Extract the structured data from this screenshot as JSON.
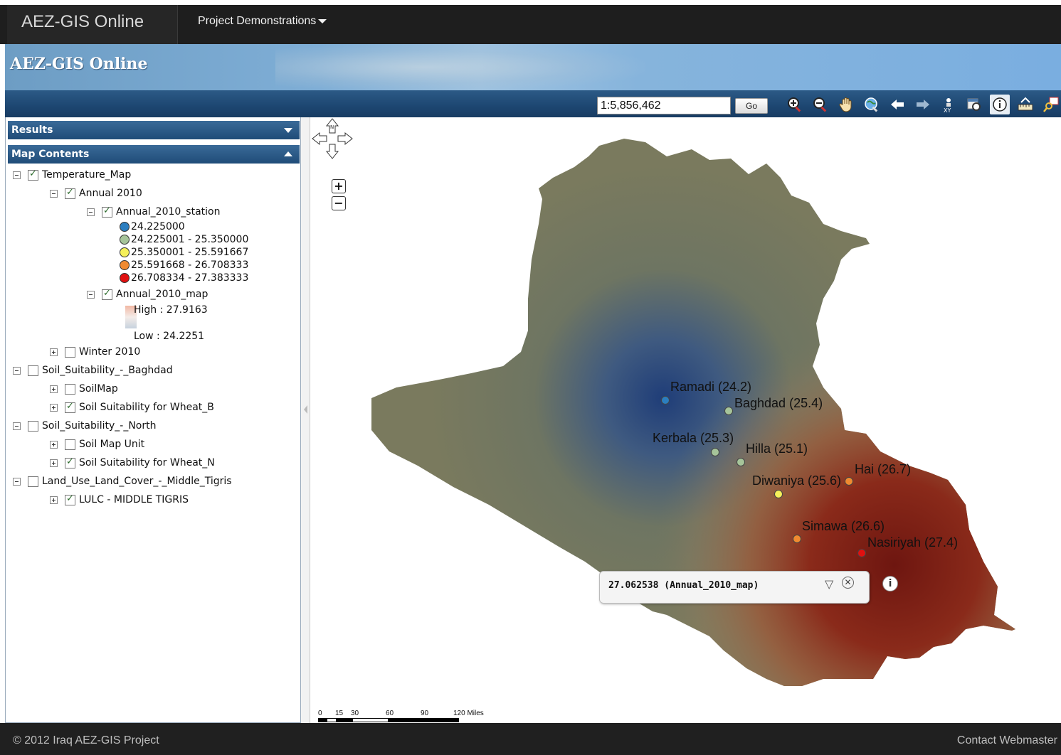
{
  "app": {
    "brand": "AEZ-GIS Online",
    "menu_label": "Project Demonstrations",
    "banner_title": "AEZ-GIS Online"
  },
  "toolbar": {
    "scale_value": "1:5,856,462",
    "go_label": "Go",
    "tools": [
      "zoom-in-icon",
      "zoom-out-icon",
      "pan-hand-icon",
      "full-extent-globe-icon",
      "previous-extent-arrow-icon",
      "next-extent-arrow-icon",
      "xy-coordinate-icon",
      "zoom-to-layer-icon",
      "identify-info-icon",
      "measure-ruler-icon",
      "magnifier-icon"
    ]
  },
  "panels": {
    "results": "Results",
    "map_contents": "Map Contents"
  },
  "tree": {
    "temperature_map": "Temperature_Map",
    "annual_2010": "Annual 2010",
    "annual_station": "Annual_2010_station",
    "station_legend": [
      {
        "label": "24.225000",
        "color": "#2b7ec0"
      },
      {
        "label": "24.225001 - 25.350000",
        "color": "#a6c49a"
      },
      {
        "label": "25.350001 - 25.591667",
        "color": "#f5f05a"
      },
      {
        "label": "25.591668 - 26.708333",
        "color": "#f08a30"
      },
      {
        "label": "26.708334 - 27.383333",
        "color": "#e01010"
      }
    ],
    "annual_map": "Annual_2010_map",
    "high_label": "High : 27.9163",
    "low_label": "Low : 24.2251",
    "winter_2010": "Winter 2010",
    "soil_baghdad": "Soil_Suitability_-_Baghdad",
    "soilmap": "SoilMap",
    "soil_wheat_b": "Soil Suitability for Wheat_B",
    "soil_north": "Soil_Suitability_-_North",
    "soil_map_unit": "Soil Map Unit",
    "soil_wheat_n": "Soil Suitability for Wheat_N",
    "lulc": "Land_Use_Land_Cover_-_Middle_Tigris",
    "lulc_middle": "LULC - MIDDLE TIGRIS"
  },
  "map": {
    "cities": [
      {
        "name": "Ramadi (24.2)",
        "color": "#2b7ec0"
      },
      {
        "name": "Baghdad (25.4)",
        "color": "#a6c49a"
      },
      {
        "name": "Kerbala (25.3)",
        "color": "#a6c49a"
      },
      {
        "name": "Hilla (25.1)",
        "color": "#a6c49a"
      },
      {
        "name": "Hai (26.7)",
        "color": "#f08a30"
      },
      {
        "name": "Diwaniya (25.6)",
        "color": "#f5f05a"
      },
      {
        "name": "Simawa (26.6)",
        "color": "#f08a30"
      },
      {
        "name": "Nasiriyah (27.4)",
        "color": "#e01010"
      }
    ],
    "popup_text": "27.062538 (Annual_2010_map)",
    "scale_labels": [
      "0",
      "15",
      "30",
      "60",
      "90",
      "120 Miles"
    ]
  },
  "footer": {
    "copyright": "© 2012 Iraq AEZ-GIS Project",
    "contact": "Contact Webmaster"
  }
}
